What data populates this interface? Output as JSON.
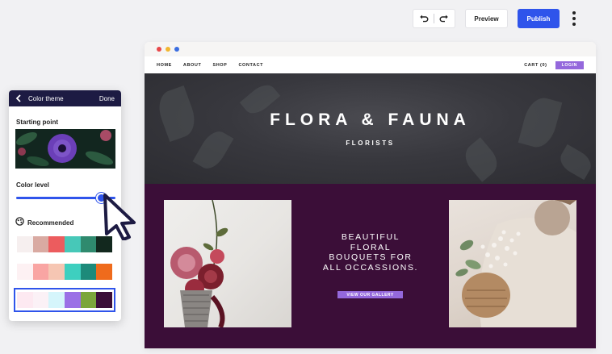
{
  "toolbar": {
    "undo_icon": "undo-icon",
    "redo_icon": "redo-icon",
    "preview_label": "Preview",
    "publish_label": "Publish",
    "more_icon": "more-vertical-icon"
  },
  "colors": {
    "accent": "#2f54eb",
    "site_purple": "#9468dc",
    "site_bg": "#3b0e38",
    "panel_header": "#1d1b43",
    "window_dots": [
      "#e8484a",
      "#f2b630",
      "#3a6de0"
    ]
  },
  "site": {
    "nav": [
      "HOME",
      "ABOUT",
      "SHOP",
      "CONTACT"
    ],
    "cart": "CART (0)",
    "login": "LOGIN",
    "hero_title": "FLORA & FAUNA",
    "hero_subtitle": "FLORISTS",
    "tagline": [
      "BEAUTIFUL",
      "FLORAL",
      "BOUQUETS FOR",
      "ALL OCCASSIONS."
    ],
    "gallery_button": "VIEW OUR GALLERY"
  },
  "panel": {
    "title": "Color theme",
    "done": "Done",
    "starting_point": "Starting point",
    "color_level": "Color level",
    "color_level_value": 0.9,
    "recommended": "Recommended",
    "palettes": [
      [
        "#f6efef",
        "#d9aaa2",
        "#ec5c5e",
        "#47c8b8",
        "#2f8a6e",
        "#12281e"
      ],
      [
        "#fdf1f3",
        "#f9a5a3",
        "#f6c6b3",
        "#3ecfbf",
        "#1d8a7a",
        "#ef6b1c"
      ],
      [
        "#fde9f1",
        "#fbf1f6",
        "#d5f5fb",
        "#9b70e6",
        "#7ba63a",
        "#3b0e38"
      ]
    ],
    "selected_palette": 2
  }
}
